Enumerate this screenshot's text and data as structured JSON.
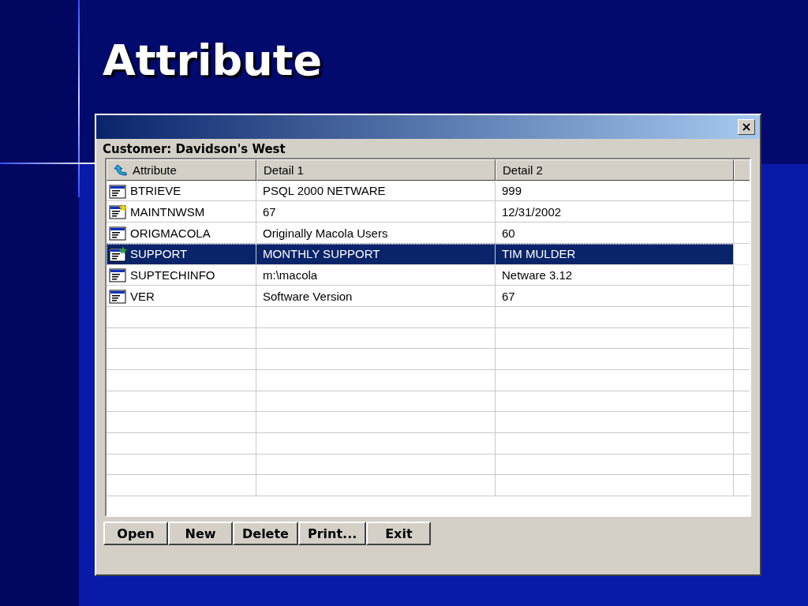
{
  "slide": {
    "title": "Attribute"
  },
  "window": {
    "customer_label": "Customer: Davidson's West",
    "close": "×"
  },
  "table": {
    "columns": [
      "Attribute",
      "Detail 1",
      "Detail 2"
    ],
    "rows": [
      {
        "kind": "plain",
        "selected": false,
        "cells": [
          "BTRIEVE",
          "PSQL 2000 NETWARE",
          "999"
        ]
      },
      {
        "kind": "flagged",
        "color": "#f0d000",
        "selected": false,
        "cells": [
          "MAINTNWSM",
          "67",
          "12/31/2002"
        ]
      },
      {
        "kind": "plain",
        "selected": false,
        "cells": [
          "ORIGMACOLA",
          "Originally Macola Users",
          "60"
        ]
      },
      {
        "kind": "flagged",
        "color": "#20a040",
        "selected": true,
        "cells": [
          "SUPPORT",
          "MONTHLY SUPPORT",
          "TIM MULDER"
        ]
      },
      {
        "kind": "plain",
        "selected": false,
        "cells": [
          "SUPTECHINFO",
          "m:\\macola",
          "Netware 3.12"
        ]
      },
      {
        "kind": "plain",
        "selected": false,
        "cells": [
          "VER",
          "Software Version",
          "67"
        ]
      }
    ]
  },
  "buttons": [
    "Open",
    "New",
    "Delete",
    "Print...",
    "Exit"
  ]
}
